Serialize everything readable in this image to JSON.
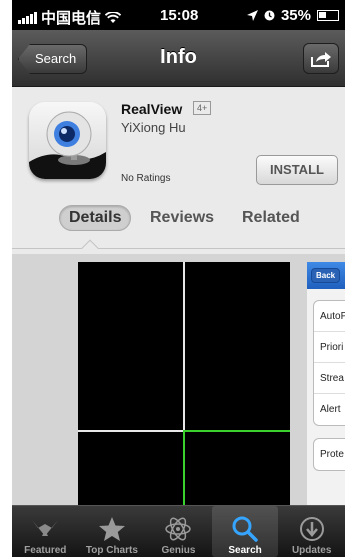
{
  "status_bar": {
    "carrier": "中国电信",
    "time": "15:08",
    "battery": "35%"
  },
  "nav": {
    "back_label": "Search",
    "title": "Info"
  },
  "app": {
    "name": "RealView",
    "age_rating": "4+",
    "developer": "YiXiong Hu",
    "ratings": "No Ratings",
    "install_label": "INSTALL"
  },
  "tabs": [
    {
      "label": "Details",
      "active": true
    },
    {
      "label": "Reviews",
      "active": false
    },
    {
      "label": "Related",
      "active": false
    }
  ],
  "screenshot2": {
    "back_label": "Back",
    "group1": [
      "AutoP",
      "Priori",
      "Strea",
      "Alert"
    ],
    "group2": [
      "Prote"
    ]
  },
  "tabbar": [
    {
      "label": "Featured",
      "icon": "featured-icon",
      "active": false
    },
    {
      "label": "Top Charts",
      "icon": "star-icon",
      "active": false
    },
    {
      "label": "Genius",
      "icon": "atom-icon",
      "active": false
    },
    {
      "label": "Search",
      "icon": "search-icon",
      "active": true
    },
    {
      "label": "Updates",
      "icon": "updates-icon",
      "active": false
    }
  ],
  "colors": {
    "accent_blue": "#3f8ae6",
    "grid_green": "#3ad12e"
  }
}
